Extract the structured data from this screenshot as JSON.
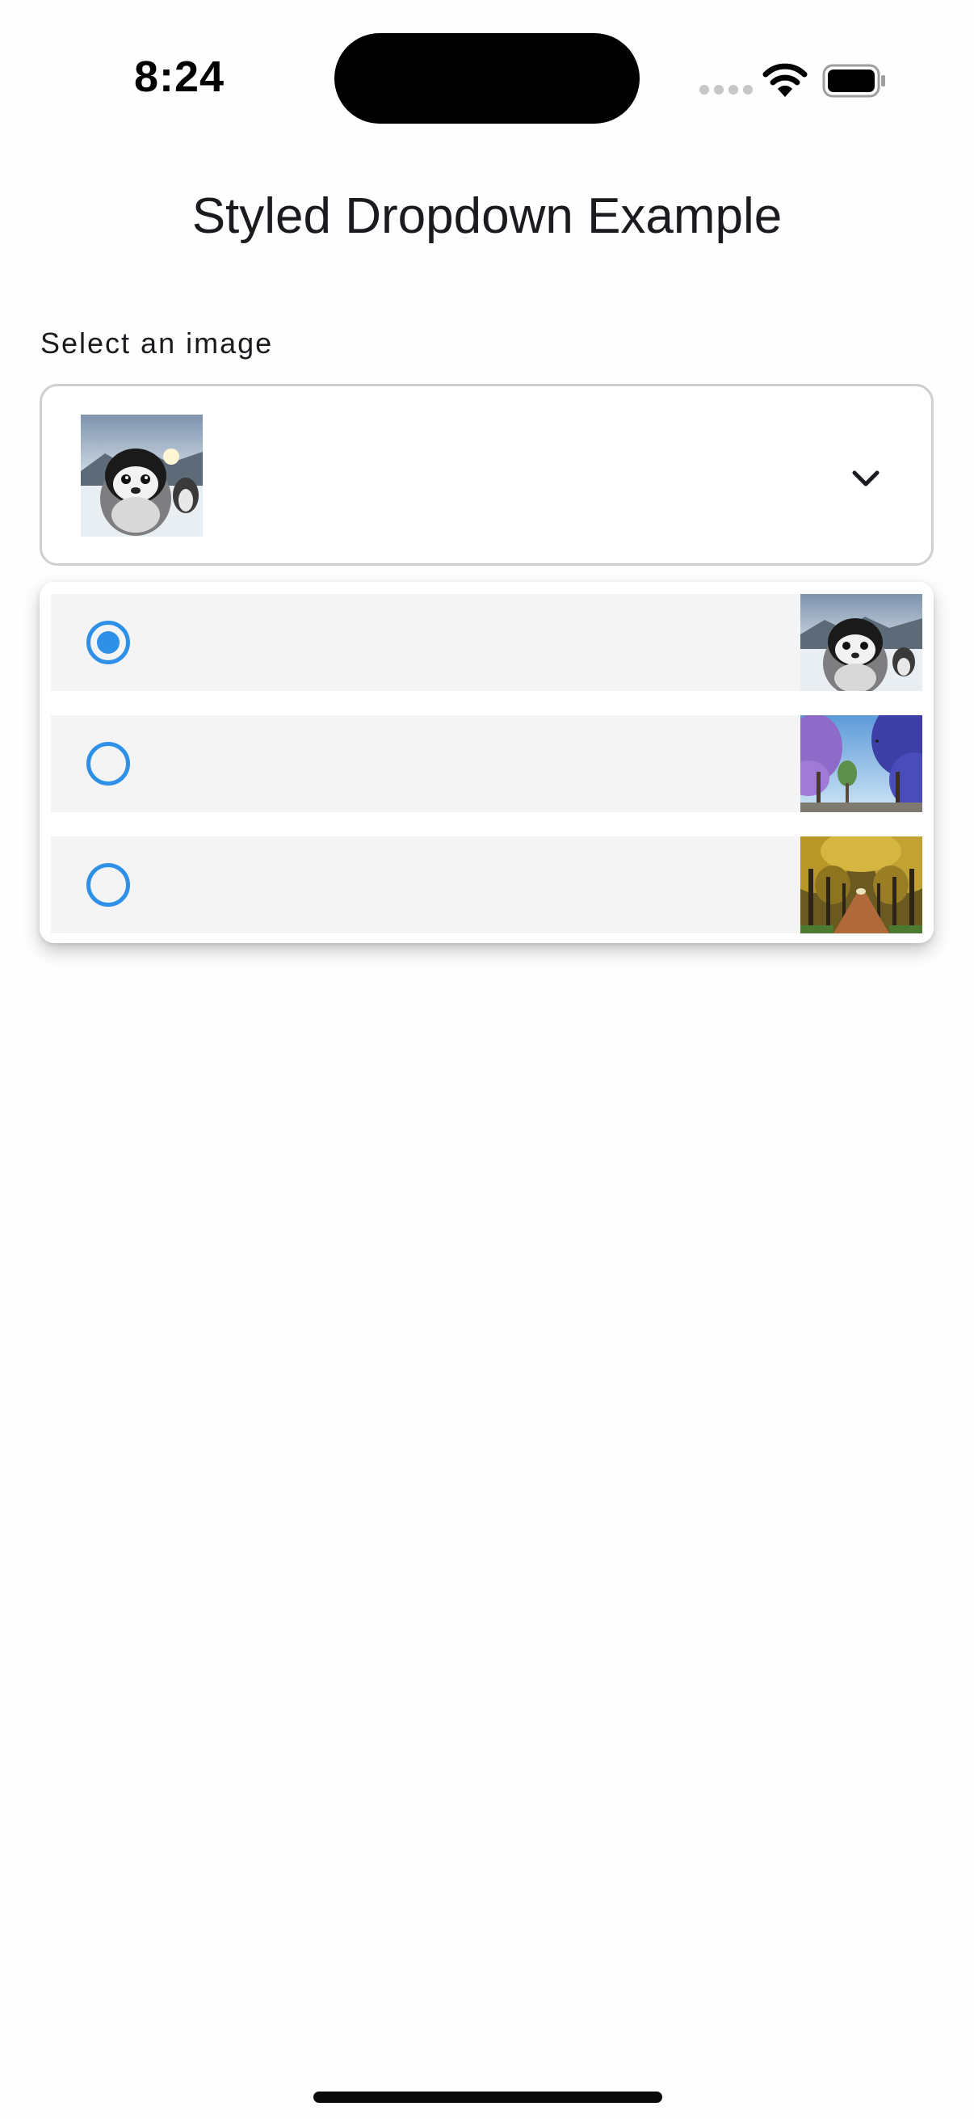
{
  "status_bar": {
    "time": "8:24",
    "icons": [
      "signal-dots-icon",
      "wifi-icon",
      "battery-icon"
    ]
  },
  "header": {
    "title": "Styled Dropdown Example"
  },
  "form": {
    "label": "Select an image",
    "selected_image": "penguin-image",
    "chevron_icon": "chevron-down-icon"
  },
  "menu": {
    "options": [
      {
        "image": "penguin-image",
        "selected": true
      },
      {
        "image": "purple-trees-sky-image",
        "selected": false
      },
      {
        "image": "autumn-tree-path-image",
        "selected": false
      }
    ]
  },
  "colors": {
    "accent": "#2e90e6",
    "option_background": "#f4f4f4",
    "border": "#cfcfcf",
    "text": "#1b1b1f"
  }
}
